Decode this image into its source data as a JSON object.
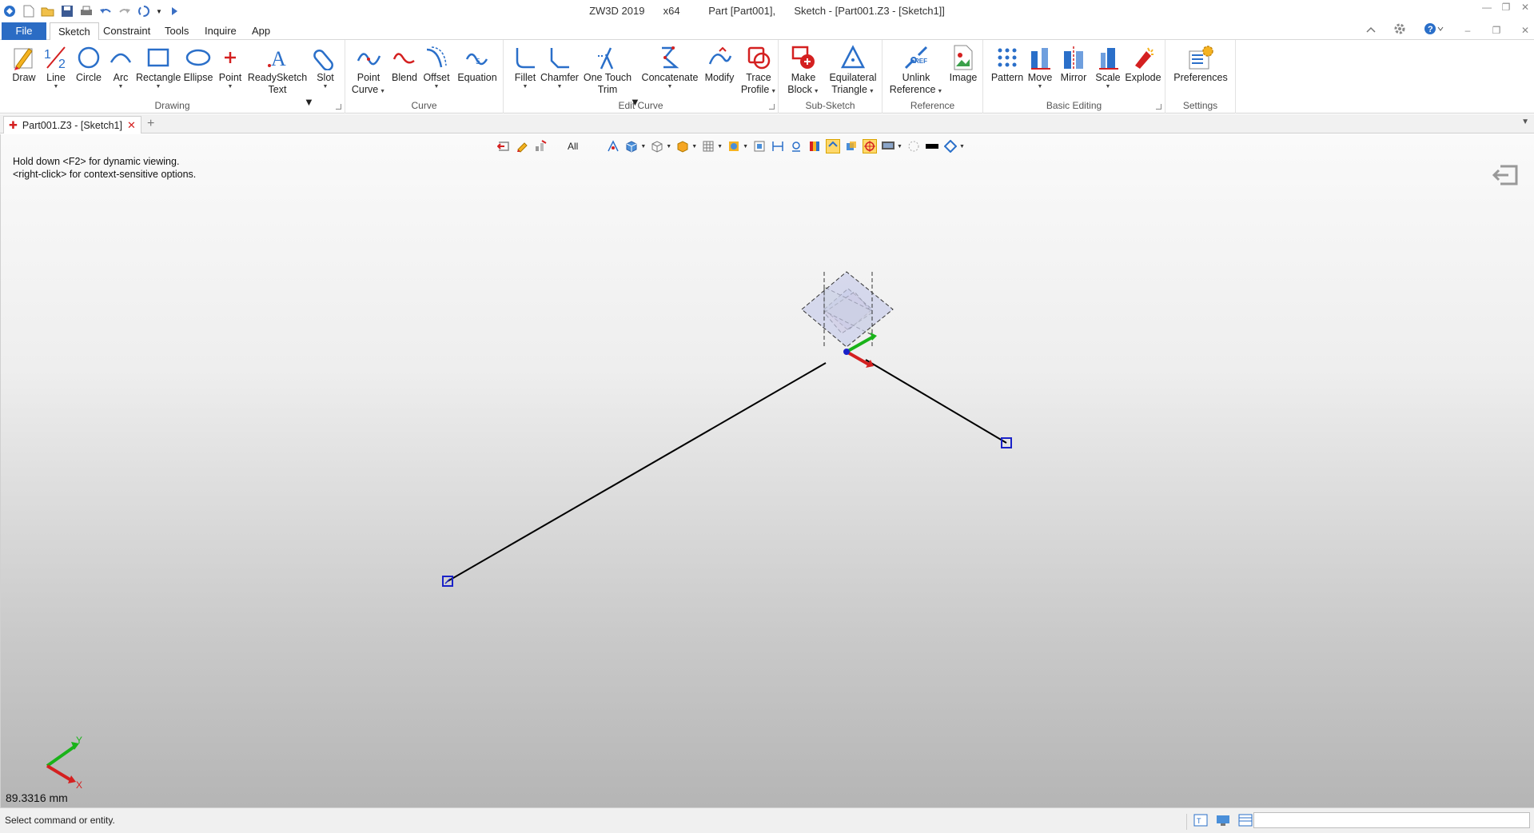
{
  "window": {
    "app": "ZW3D 2019",
    "arch": "x64",
    "document": "Part [Part001],",
    "context": "Sketch - [Part001.Z3 - [Sketch1]]"
  },
  "menu": {
    "file": "File",
    "tabs": [
      "Sketch",
      "Constraint",
      "Tools",
      "Inquire",
      "App"
    ]
  },
  "ribbon": {
    "groups": {
      "drawing": "Drawing",
      "curve": "Curve",
      "edit_curve": "Edit Curve",
      "sub_sketch": "Sub-Sketch",
      "reference": "Reference",
      "basic_editing": "Basic Editing",
      "settings": "Settings"
    },
    "tools": {
      "draw": "Draw",
      "line": "Line",
      "circle": "Circle",
      "arc": "Arc",
      "rectangle": "Rectangle",
      "ellipse": "Ellipse",
      "point": "Point",
      "readysketch_1": "ReadySketch",
      "readysketch_2": "Text",
      "slot": "Slot",
      "point_curve_1": "Point",
      "point_curve_2": "Curve",
      "blend": "Blend",
      "offset": "Offset",
      "equation": "Equation",
      "fillet": "Fillet",
      "chamfer": "Chamfer",
      "onetouch_1": "One Touch",
      "onetouch_2": "Trim",
      "concatenate": "Concatenate",
      "modify": "Modify",
      "trace_1": "Trace",
      "trace_2": "Profile",
      "makeblock_1": "Make",
      "makeblock_2": "Block",
      "equi_1": "Equilateral",
      "equi_2": "Triangle",
      "unlink_1": "Unlink",
      "unlink_2": "Reference",
      "image": "Image",
      "pattern": "Pattern",
      "move": "Move",
      "mirror": "Mirror",
      "scale": "Scale",
      "explode": "Explode",
      "preferences": "Preferences"
    }
  },
  "doc_tab": {
    "label": "Part001.Z3 - [Sketch1]"
  },
  "viewport": {
    "hint_line1": "Hold down <F2> for dynamic viewing.",
    "hint_line2": "<right-click> for context-sensitive options.",
    "filter": "All",
    "triad_y": "Y",
    "triad_x": "X",
    "distance": "89.3316 mm"
  },
  "status": {
    "text": "Select command or entity."
  },
  "colors": {
    "file_tab": "#2b6cc4",
    "sketch_line": "#000000",
    "endpoint_marker": "#1a22c8",
    "axis_x": "#d42020",
    "axis_y": "#19b319",
    "highlight": "#ffd86b"
  },
  "icons": [
    "app-logo-icon",
    "new-icon",
    "open-icon",
    "save-icon",
    "print-icon",
    "undo-icon",
    "redo-icon",
    "exit-sketch-icon"
  ]
}
